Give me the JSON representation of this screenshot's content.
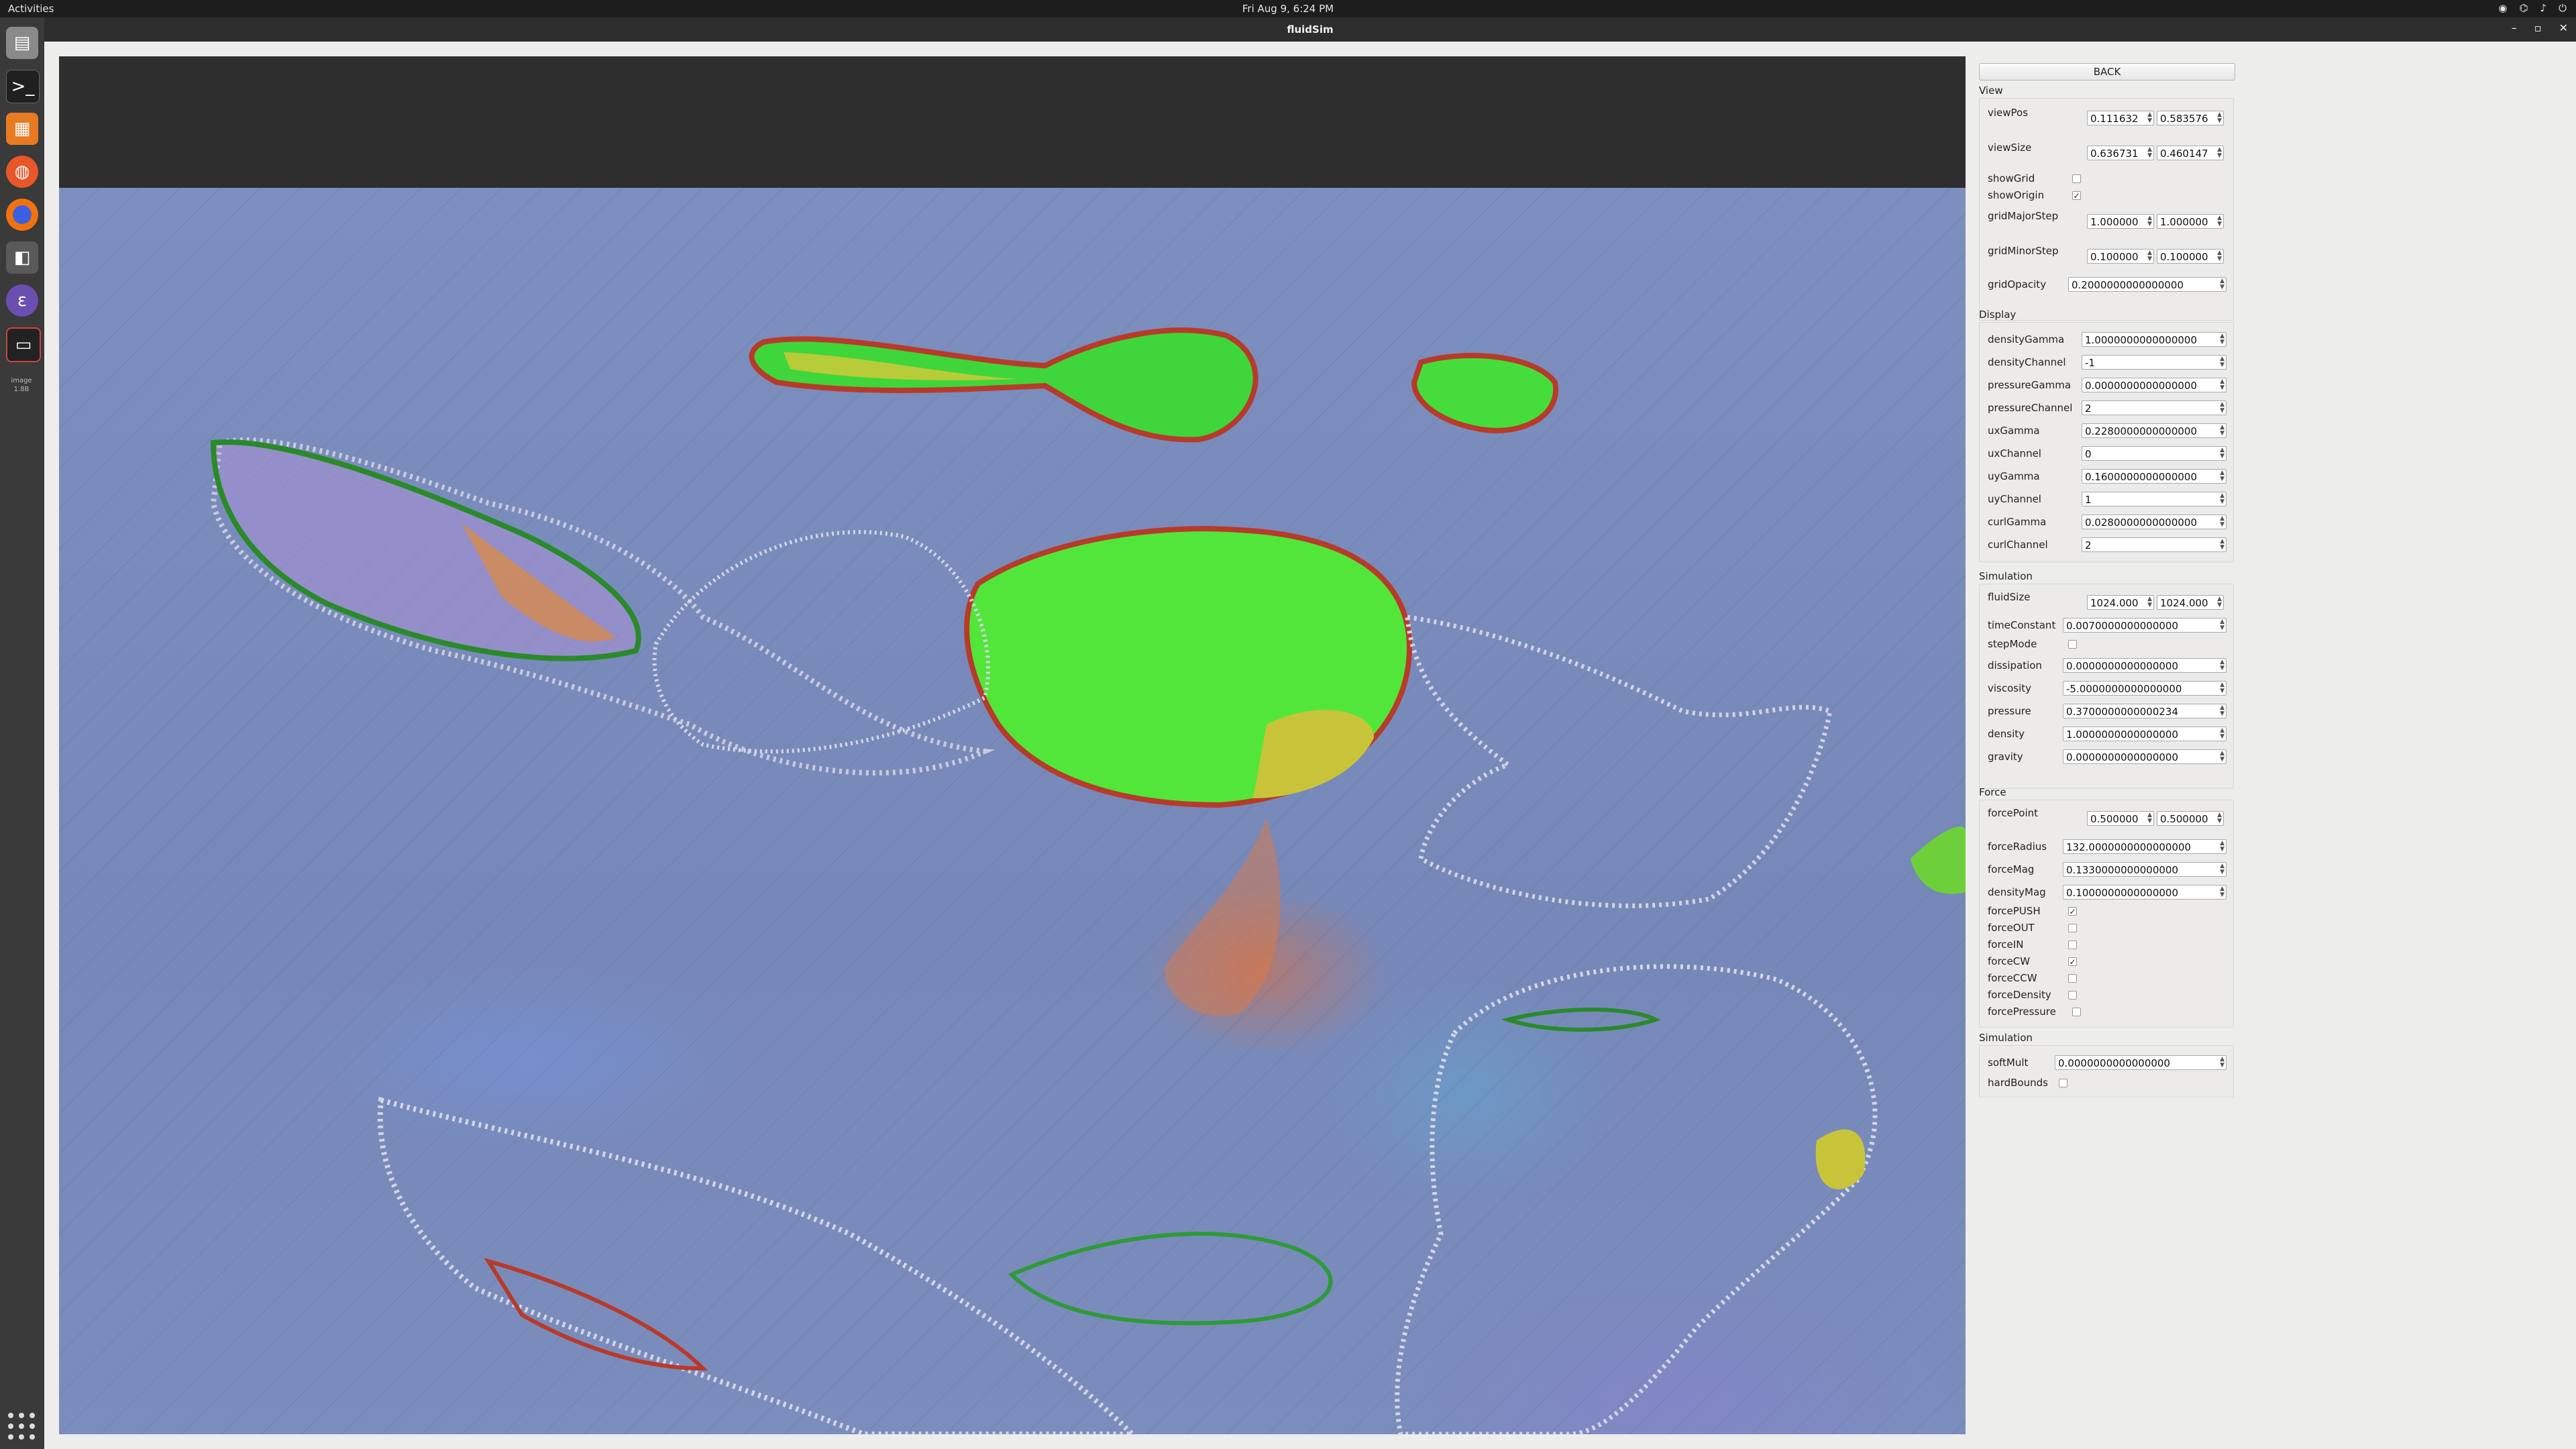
{
  "topbar": {
    "activities": "Activities",
    "clock": "Fri Aug  9,  6:24 PM",
    "tray_icons": [
      "steam-icon",
      "network-icon",
      "volume-icon",
      "power-icon"
    ]
  },
  "window": {
    "title": "fluidSim",
    "controls": [
      "–",
      "▫",
      "✕"
    ]
  },
  "dock": {
    "items": [
      "files-icon",
      "terminal-icon",
      "archive-icon",
      "ubuntu-software-icon",
      "firefox-icon",
      "screenshot-icon",
      "emacs-icon",
      "image-viewer-icon"
    ],
    "label": "image",
    "sublabel": "1.8B"
  },
  "panel": {
    "back_label": "BACK",
    "view": {
      "title": "View",
      "viewPos": {
        "label": "viewPos",
        "x": "0.111632",
        "y": "0.583576"
      },
      "viewSize": {
        "label": "viewSize",
        "x": "0.636731",
        "y": "0.460147"
      },
      "showGrid": {
        "label": "showGrid",
        "checked": false
      },
      "showOrigin": {
        "label": "showOrigin",
        "checked": true
      },
      "gridMajorStep": {
        "label": "gridMajorStep",
        "x": "1.000000",
        "y": "1.000000"
      },
      "gridMinorStep": {
        "label": "gridMinorStep",
        "x": "0.100000",
        "y": "0.100000"
      },
      "gridOpacity": {
        "label": "gridOpacity",
        "value": "0.2000000000000000"
      }
    },
    "display": {
      "title": "Display",
      "densityGamma": {
        "label": "densityGamma",
        "value": "1.0000000000000000"
      },
      "densityChannel": {
        "label": "densityChannel",
        "value": "-1"
      },
      "pressureGamma": {
        "label": "pressureGamma",
        "value": "0.0000000000000000"
      },
      "pressureChannel": {
        "label": "pressureChannel",
        "value": "2"
      },
      "uxGamma": {
        "label": "uxGamma",
        "value": "0.2280000000000000"
      },
      "uxChannel": {
        "label": "uxChannel",
        "value": "0"
      },
      "uyGamma": {
        "label": "uyGamma",
        "value": "0.1600000000000000"
      },
      "uyChannel": {
        "label": "uyChannel",
        "value": "1"
      },
      "curlGamma": {
        "label": "curlGamma",
        "value": "0.0280000000000000"
      },
      "curlChannel": {
        "label": "curlChannel",
        "value": "2"
      }
    },
    "simulation": {
      "title": "Simulation",
      "fluidSize": {
        "label": "fluidSize",
        "x": "1024.000",
        "y": "1024.000"
      },
      "timeConstant": {
        "label": "timeConstant",
        "value": "0.0070000000000000"
      },
      "stepMode": {
        "label": "stepMode",
        "checked": false
      },
      "dissipation": {
        "label": "dissipation",
        "value": "0.0000000000000000"
      },
      "viscosity": {
        "label": "viscosity",
        "value": "-5.0000000000000000"
      },
      "pressure": {
        "label": "pressure",
        "value": "0.3700000000000234"
      },
      "density": {
        "label": "density",
        "value": "1.0000000000000000"
      },
      "gravity": {
        "label": "gravity",
        "value": "0.0000000000000000"
      }
    },
    "force": {
      "title": "Force",
      "forcePoint": {
        "label": "forcePoint",
        "x": "0.500000",
        "y": "0.500000"
      },
      "forceRadius": {
        "label": "forceRadius",
        "value": "132.0000000000000000"
      },
      "forceMag": {
        "label": "forceMag",
        "value": "0.1330000000000000"
      },
      "densityMag": {
        "label": "densityMag",
        "value": "0.1000000000000000"
      },
      "forcePUSH": {
        "label": "forcePUSH",
        "checked": true
      },
      "forceOUT": {
        "label": "forceOUT",
        "checked": false
      },
      "forceIN": {
        "label": "forceIN",
        "checked": false
      },
      "forceCW": {
        "label": "forceCW",
        "checked": true
      },
      "forceCCW": {
        "label": "forceCCW",
        "checked": false
      },
      "forceDensity": {
        "label": "forceDensity",
        "checked": false
      },
      "forcePressure": {
        "label": "forcePressure",
        "checked": false
      }
    },
    "simulation2": {
      "title": "Simulation",
      "softMult": {
        "label": "softMult",
        "value": "0.0000000000000000"
      },
      "hardBounds": {
        "label": "hardBounds",
        "checked": false
      }
    }
  },
  "colors": {
    "fluid_background": "#7a8cbc",
    "blob_green": "#5be040",
    "edge_red": "#d84030"
  }
}
